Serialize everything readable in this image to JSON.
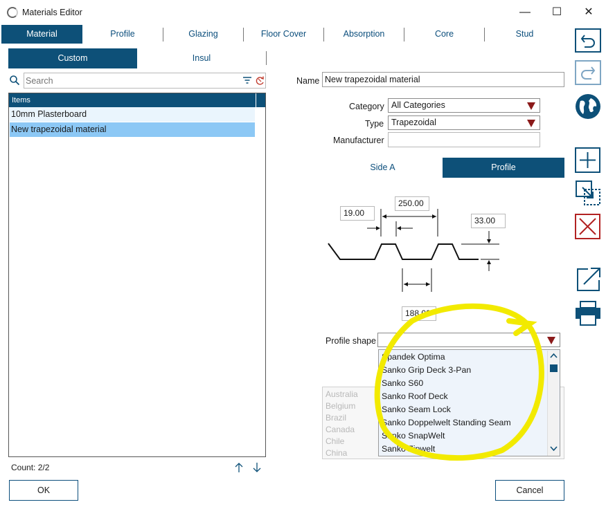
{
  "window": {
    "title": "Materials Editor",
    "minimize": "—",
    "maximize": "☐",
    "close": "✕"
  },
  "tabs": [
    "Material",
    "Profile",
    "Glazing",
    "Floor Cover",
    "Absorption",
    "Core",
    "Stud"
  ],
  "subtabs": [
    "Custom",
    "Insul"
  ],
  "search": {
    "placeholder": "Search"
  },
  "list": {
    "header": "Items",
    "items": [
      "10mm Plasterboard",
      "New trapezoidal material"
    ],
    "count": "Count: 2/2"
  },
  "form": {
    "name_label": "Name",
    "name_value": "New trapezoidal material",
    "category_label": "Category",
    "category_value": "All Categories",
    "type_label": "Type",
    "type_value": "Trapezoidal",
    "manufacturer_label": "Manufacturer",
    "manufacturer_value": ""
  },
  "view_toggle": [
    "Side A",
    "Profile"
  ],
  "profile_dims": {
    "left_width": "19.00",
    "pitch": "250.00",
    "height": "33.00",
    "bottom_width": "188.00"
  },
  "profile_shape": {
    "label": "Profile shape",
    "value": "",
    "options": [
      "Spandek Optima",
      "Sanko Grip Deck 3-Pan",
      "Sanko S60",
      "Sanko Roof Deck",
      "Sanko Seam Lock",
      "Sanko Doppelwelt Standing Seam",
      "Sanko SnapWelt",
      "Sanko Zipwelt"
    ]
  },
  "countries": [
    "Australia",
    "Belgium",
    "Brazil",
    "Canada",
    "Chile",
    "China"
  ],
  "buttons": {
    "ok": "OK",
    "cancel": "Cancel"
  },
  "side_toolbar": [
    "undo-icon",
    "redo-icon",
    "globe-icon",
    "add-icon",
    "move-icon",
    "delete-icon",
    "export-icon",
    "print-icon"
  ],
  "colors": {
    "accent": "#0d5078",
    "selection": "#8cc8f5",
    "highlight": "#f2ea00",
    "delete": "#b22222"
  }
}
